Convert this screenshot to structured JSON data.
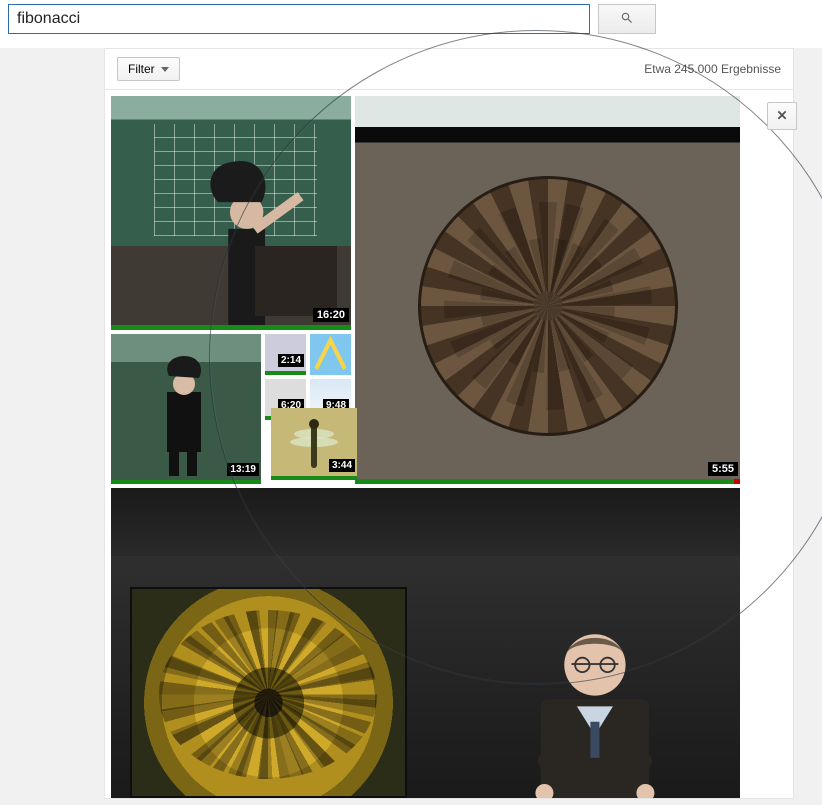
{
  "search": {
    "value": "fibonacci",
    "placeholder": ""
  },
  "header": {
    "filter_label": "Filter",
    "results_count_text": "Etwa 245.000 Ergebnisse"
  },
  "close_glyph": "✕",
  "thumbs": {
    "chalkboard_lecture": {
      "duration": "16:20"
    },
    "pinecone": {
      "duration": "5:55"
    },
    "lecture_small": {
      "duration": "13:19"
    },
    "abstract_a": {
      "duration": "2:14"
    },
    "abstract_b": {
      "duration": "6:20"
    },
    "abstract_c": {
      "duration": "9:48"
    },
    "dragonfly": {
      "duration": "3:44"
    }
  }
}
